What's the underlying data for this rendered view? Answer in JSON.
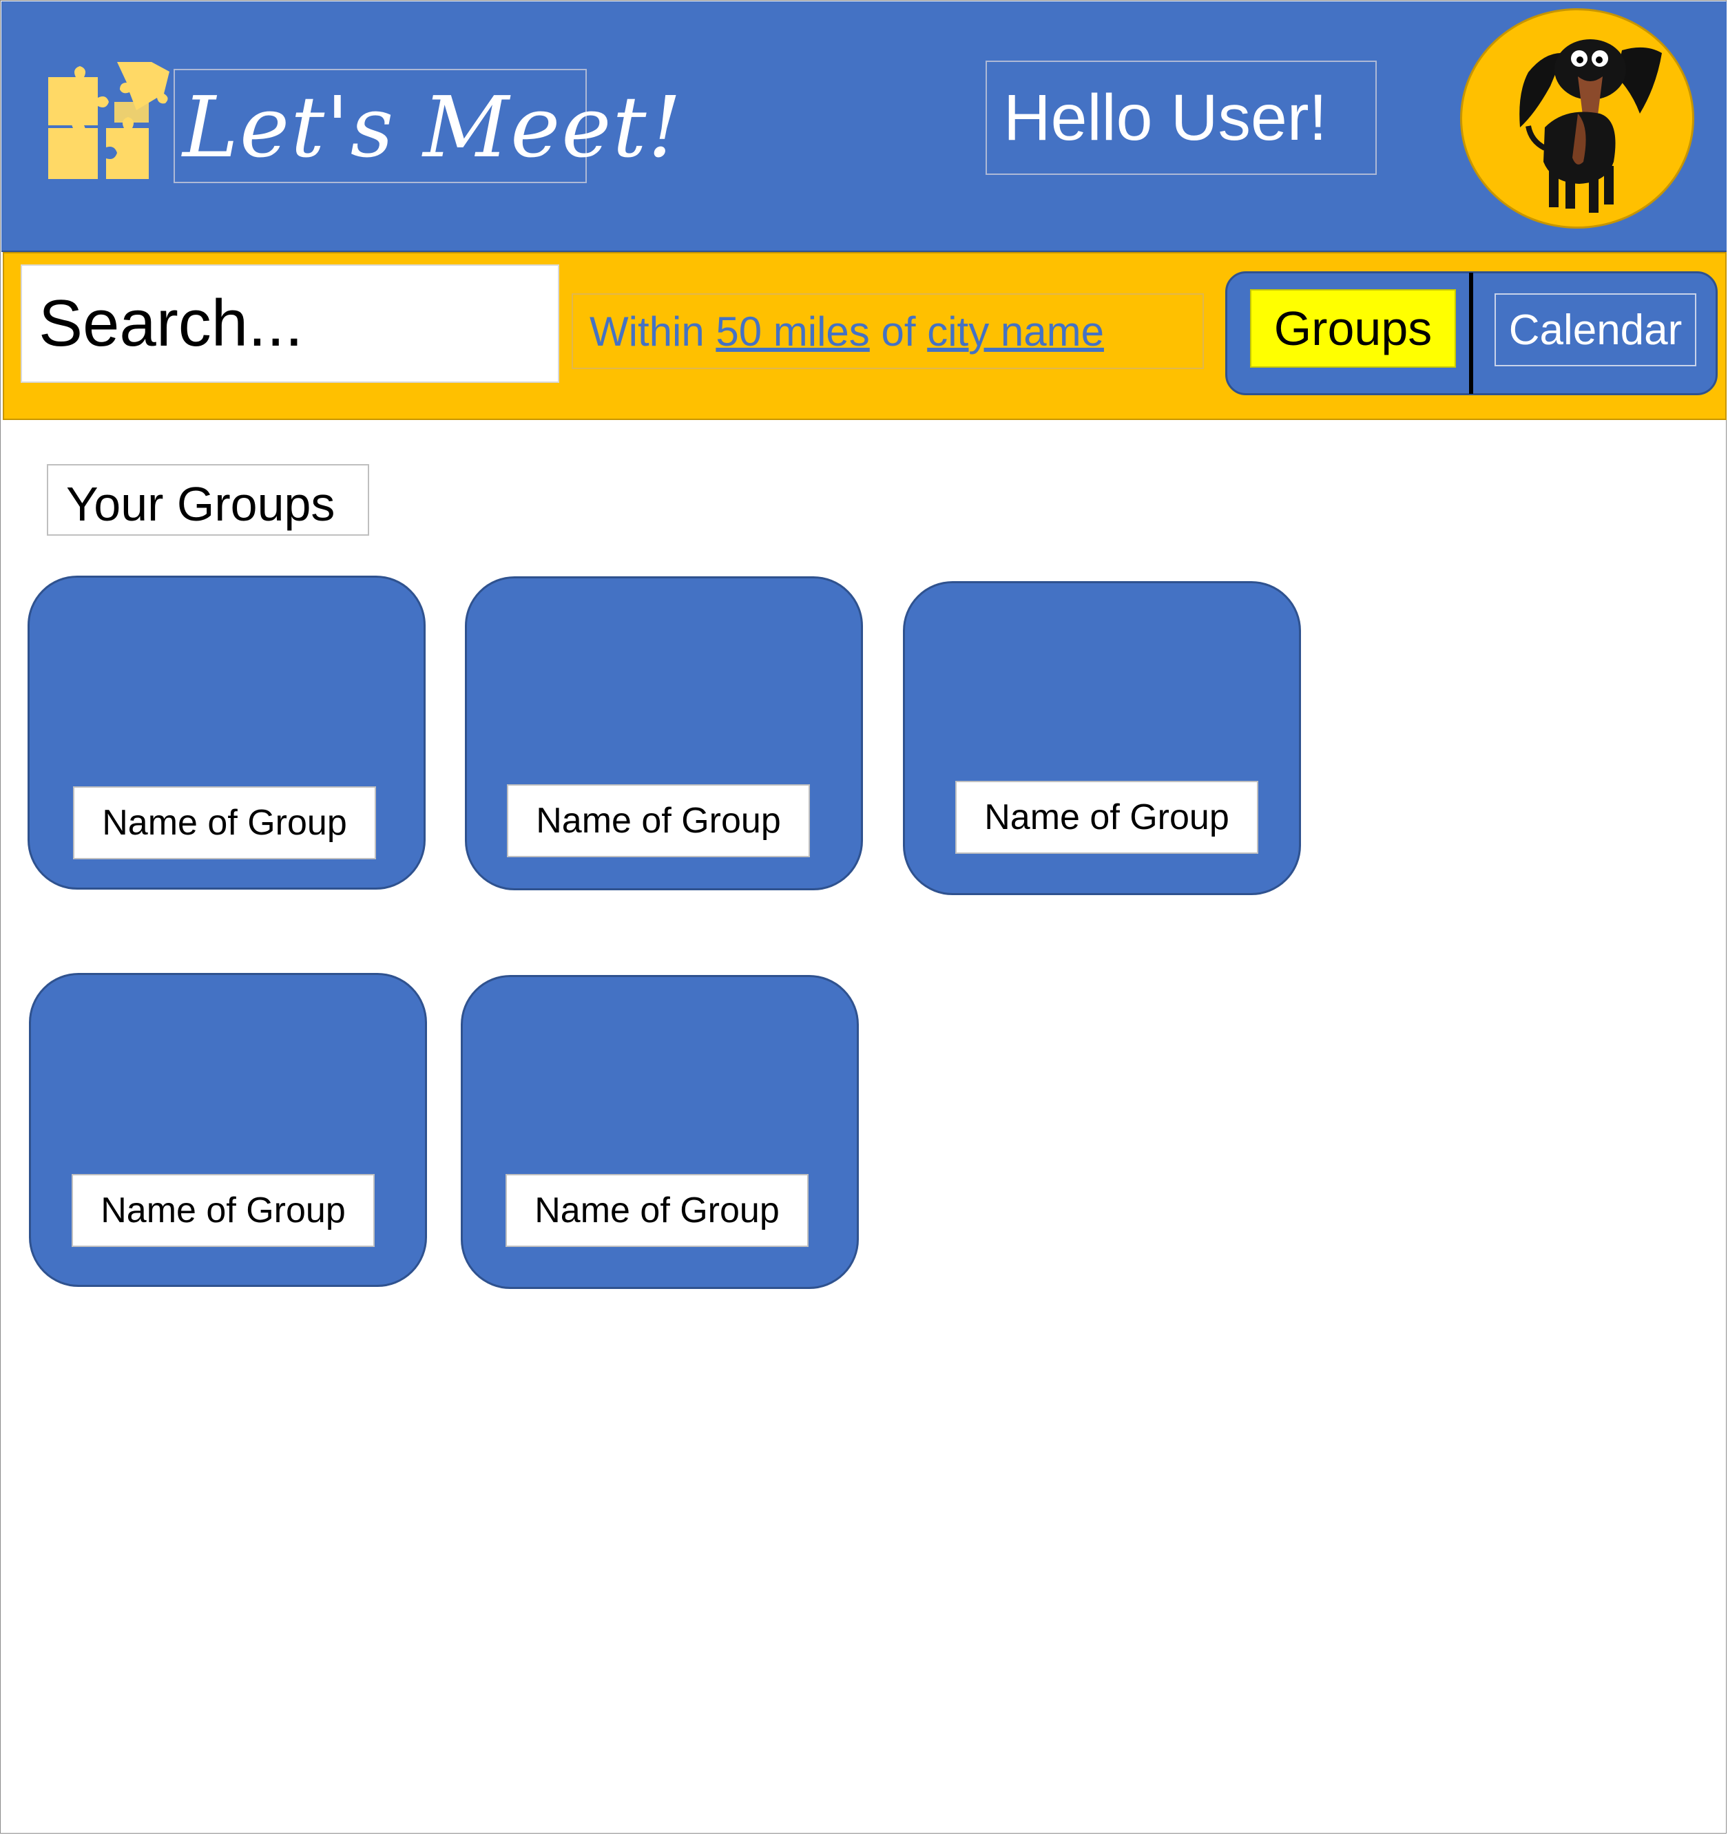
{
  "header": {
    "logo_text": "Let's Meet!",
    "greeting": "Hello User!",
    "brand_color": "#4472c4",
    "accent_color": "#ffc000",
    "logo_icon": "puzzle-pieces-icon",
    "avatar": "dachshund-avatar"
  },
  "toolbar": {
    "search_placeholder": "Search...",
    "location_prefix": "Within ",
    "distance_link": "50 miles",
    "location_middle": " of ",
    "city_link": "city name",
    "tabs": [
      {
        "label": "Groups",
        "active": true
      },
      {
        "label": "Calendar",
        "active": false
      }
    ]
  },
  "main": {
    "section_title": "Your Groups",
    "groups": [
      {
        "name": "Name of Group"
      },
      {
        "name": "Name of Group"
      },
      {
        "name": "Name of Group"
      },
      {
        "name": "Name of Group"
      },
      {
        "name": "Name of Group"
      }
    ]
  }
}
